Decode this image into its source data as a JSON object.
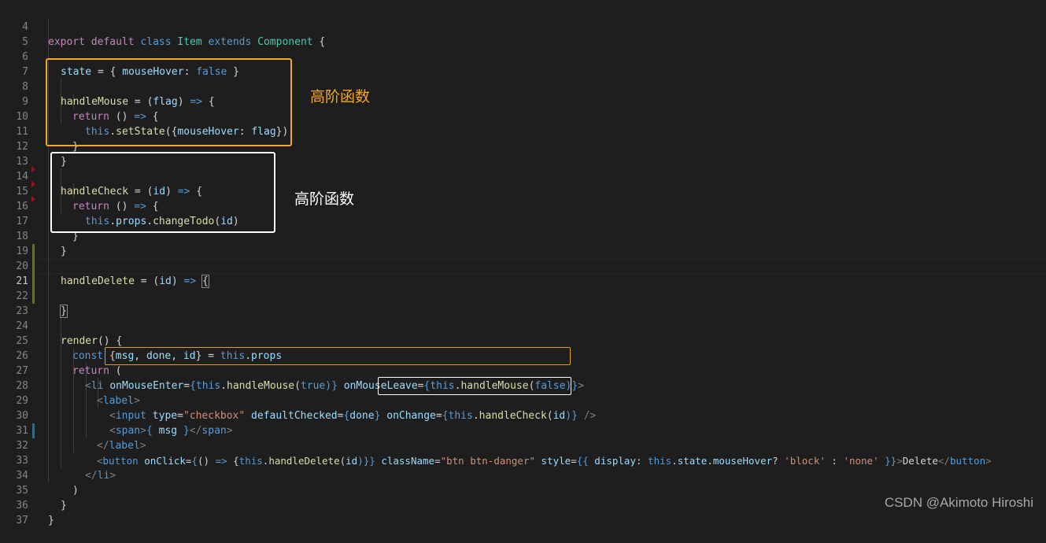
{
  "editor": {
    "line_numbers": [
      "4",
      "5",
      "6",
      "7",
      "8",
      "9",
      "10",
      "11",
      "12",
      "13",
      "14",
      "15",
      "16",
      "17",
      "18",
      "19",
      "20",
      "21",
      "22",
      "23",
      "24",
      "25",
      "26",
      "27",
      "28",
      "29",
      "30",
      "31",
      "32",
      "33",
      "34",
      "35",
      "36",
      "37"
    ],
    "active_line": "21",
    "code": {
      "l4": {
        "export": "export",
        "default": "default",
        "class": "class",
        "name": "Item",
        "extends": "extends",
        "base": "Component",
        "brace": " {"
      },
      "l6": {
        "state": "state",
        "eq": " = { ",
        "key": "mouseHover",
        "colon": ": ",
        "val": "false",
        "close": " }"
      },
      "l8": {
        "fn": "handleMouse",
        "eq": " = (",
        "arg": "flag",
        "close": ") ",
        "arrow": "=>",
        "brace": " {"
      },
      "l9": {
        "ret": "return",
        "rest": " () ",
        "arrow": "=>",
        "brace": " {"
      },
      "l10": {
        "this": "this",
        "dot": ".",
        "call": "setState",
        "open": "({",
        "key": "mouseHover",
        "colon": ": ",
        "arg": "flag",
        "close": "})"
      },
      "l11": {
        "text": "}"
      },
      "l12": {
        "text": "}"
      },
      "l14": {
        "fn": "handleCheck",
        "eq": " = (",
        "arg": "id",
        "close": ") ",
        "arrow": "=>",
        "brace": " {"
      },
      "l15": {
        "ret": "return",
        "rest": " () ",
        "arrow": "=>",
        "brace": " {"
      },
      "l16": {
        "this": "this",
        "dot": ".",
        "props": "props",
        "dot2": ".",
        "call": "changeTodo",
        "open": "(",
        "arg": "id",
        "close": ")"
      },
      "l17": {
        "text": "}"
      },
      "l18": {
        "text": "}"
      },
      "l20": {
        "fn": "handleDelete",
        "eq": " = (",
        "arg": "id",
        "close": ") ",
        "arrow": "=>",
        "sp": " ",
        "brace": "{"
      },
      "l22": {
        "text": "}"
      },
      "l24": {
        "fn": "render",
        "rest": "() {"
      },
      "l25": {
        "const": "const",
        "open": " {",
        "a": "msg",
        "c1": ", ",
        "b": "done",
        "c2": ", ",
        "d": "id",
        "close": "} = ",
        "this": "this",
        "dot": ".",
        "props": "props"
      },
      "l26": {
        "ret": "return",
        "rest": " ("
      },
      "l27": {
        "lt": "<",
        "tag": "li",
        "sp": " ",
        "attr1": "onMouseEnter",
        "eq1": "=",
        "ob1": "{",
        "this1": "this",
        "dot1": ".",
        "fn1": "handleMouse",
        "p1": "(",
        "arg1": "true",
        "cb1": ")}",
        "sp2": " ",
        "attr2": "onMouseLeave",
        "eq2": "=",
        "ob2": "{",
        "this2": "this",
        "dot2": ".",
        "fn2": "handleMouse",
        "p2": "(",
        "arg2": "false",
        "cb2": ")}",
        "gt": ">"
      },
      "l28": {
        "lt": "<",
        "tag": "label",
        "gt": ">"
      },
      "l29": {
        "lt": "<",
        "tag": "input",
        "sp": " ",
        "attr1": "type",
        "eq1": "=",
        "str1": "\"checkbox\"",
        "sp2": " ",
        "attr2": "defaultChecked",
        "eq2": "=",
        "ob2": "{",
        "arg2": "done",
        "cb2": "}",
        "sp3": " ",
        "attr3": "onChange",
        "eq3": "=",
        "ob3": "{",
        "this3": "this",
        "dot3": ".",
        "fn3": "handleCheck",
        "p3": "(",
        "arg3": "id",
        "cb3": ")}",
        "end": " />"
      },
      "l30": {
        "lt": "<",
        "tag": "span",
        "gt": ">",
        "ob": "{ ",
        "var": "msg",
        "cb": " }",
        "lt2": "</",
        "tag2": "span",
        "gt2": ">"
      },
      "l31": {
        "lt": "</",
        "tag": "label",
        "gt": ">"
      },
      "l32": {
        "lt": "<",
        "tag": "button",
        "sp": " ",
        "attr1": "onClick",
        "eq1": "=",
        "ob1": "{",
        "arrowp": "() ",
        "arrow": "=>",
        "sp1": " {",
        "this1": "this",
        "dot1": ".",
        "fn1": "handleDelete",
        "p1": "(",
        "arg1": "id",
        "cb1": ")}}",
        "sp2": " ",
        "attr2": "className",
        "eq2": "=",
        "str2": "\"btn btn-danger\"",
        "sp3": " ",
        "attr3": "style",
        "eq3": "=",
        "ob3": "{{ ",
        "key3": "display",
        "col3": ": ",
        "this3": "this",
        "dot3": ".",
        "state3": "state",
        "dot4": ".",
        "mh": "mouseHover",
        "q": "? ",
        "s1": "'block'",
        "colon": " : ",
        "s2": "'none'",
        "cb3": " }}",
        "gt": ">",
        "text": "Delete",
        "lt2": "</",
        "tag2": "button",
        "gt2": ">"
      },
      "l33": {
        "lt": "</",
        "tag": "li",
        "gt": ">"
      },
      "l34": {
        "text": ")"
      },
      "l35": {
        "text": "}"
      },
      "l36": {
        "text": "}"
      }
    }
  },
  "annotations": {
    "orange_label": "高阶函数",
    "white_label": "高阶函数",
    "orange_color": "#f5a623",
    "white_color": "#ffffff"
  },
  "watermark": "CSDN @Akimoto Hiroshi"
}
